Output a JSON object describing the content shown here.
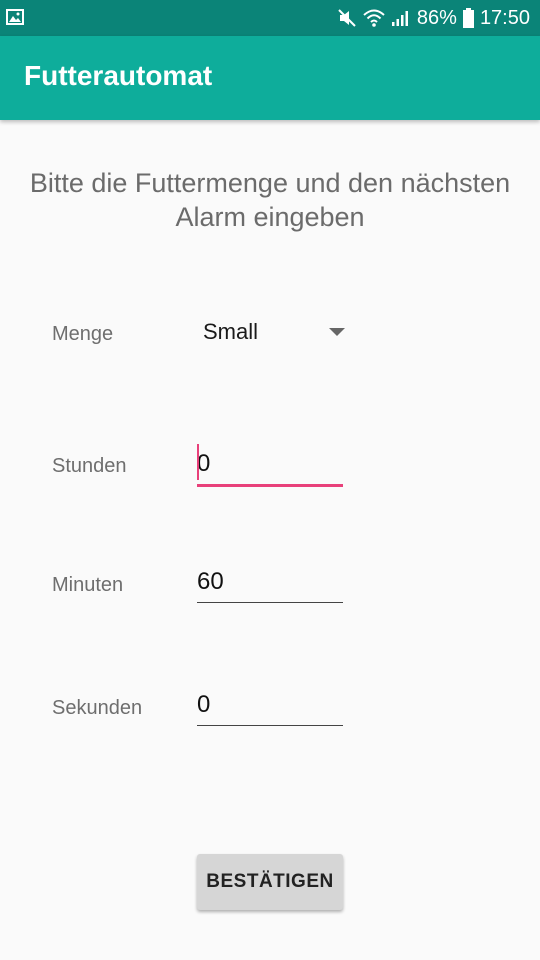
{
  "status_bar": {
    "battery": "86%",
    "time": "17:50",
    "icons": [
      "image-icon",
      "mute-icon",
      "wifi-icon",
      "signal-icon",
      "battery-icon"
    ],
    "background": "#0b8478"
  },
  "app_bar": {
    "title": "Futterautomat",
    "background": "#0ead9b"
  },
  "instruction": {
    "line1": "Bitte die Futtermenge und den nächsten",
    "line2": "Alarm eingeben"
  },
  "form": {
    "menge_label": "Menge",
    "menge_value": "Small",
    "stunden_label": "Stunden",
    "stunden_value": "0",
    "minuten_label": "Minuten",
    "minuten_value": "60",
    "sekunden_label": "Sekunden",
    "sekunden_value": "0"
  },
  "confirm_button": {
    "label": "BESTÄTIGEN"
  },
  "colors": {
    "accent": "#e8407a",
    "primary": "#0ead9b",
    "primary_dark": "#0b8478"
  }
}
